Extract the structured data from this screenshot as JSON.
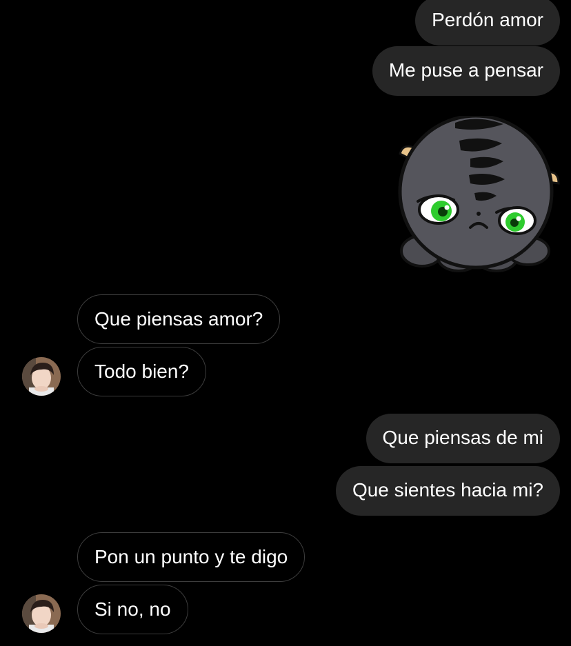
{
  "colors": {
    "background": "#000000",
    "sent_bubble": "#262626",
    "received_border": "#3d3d3d",
    "text": "#ffffff",
    "sticker_eye": "#2ecc2e"
  },
  "messages": [
    {
      "from": "me",
      "text": "Perdón amor"
    },
    {
      "from": "me",
      "text": "Me puse a pensar"
    },
    {
      "from": "me",
      "type": "sticker",
      "icon": "sad-black-cat-sticker"
    },
    {
      "from": "them",
      "text": "Que piensas amor?"
    },
    {
      "from": "them",
      "text": "Todo bien?"
    },
    {
      "from": "me",
      "text": "Que piensas de mi"
    },
    {
      "from": "me",
      "text": "Que sientes hacia mi?"
    },
    {
      "from": "them",
      "text": "Pon un punto y te digo"
    },
    {
      "from": "them",
      "text": "Si no, no"
    }
  ],
  "avatar_icon": "contact-avatar"
}
